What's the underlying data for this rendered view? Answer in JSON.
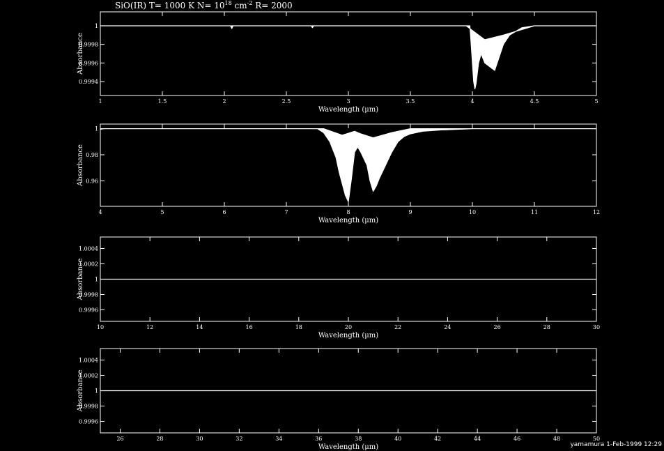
{
  "title": {
    "prefix": "SiO(IR) T= 1000 K N= 10",
    "exponent": "18",
    "unit": " cm",
    "unit_exponent": "-2",
    "suffix": " R= 2000"
  },
  "footer": "yamamura  1-Feb-1999 12:29",
  "colors": {
    "background": "#000000",
    "foreground": "#ffffff"
  },
  "chart_data": [
    {
      "type": "line",
      "xlabel": "Wavelength (μm)",
      "ylabel": "Absorbance",
      "xlim": [
        1,
        5
      ],
      "ylim": [
        0.99925,
        1.00015
      ],
      "xticks": [
        1,
        1.5,
        2,
        2.5,
        3,
        3.5,
        4,
        4.5,
        5
      ],
      "xtick_labels": [
        "1",
        "1.5",
        "2",
        "2.5",
        "3",
        "3.5",
        "4",
        "4.5",
        "5"
      ],
      "yticks": [
        0.9994,
        0.9996,
        0.9998,
        1
      ],
      "ytick_labels": [
        "0.9994",
        "0.9996",
        "0.9998",
        "1"
      ],
      "upper_envelope": {
        "x": [
          1,
          3.95,
          4.0,
          4.1,
          4.25,
          4.5,
          5
        ],
        "y": [
          1.0,
          1.0,
          0.99995,
          0.99985,
          0.9999,
          1.0,
          1.0
        ]
      },
      "lower_envelope": {
        "x": [
          1,
          2.05,
          2.06,
          2.07,
          2.7,
          2.71,
          2.72,
          3.98,
          3.99,
          4.0,
          4.01,
          4.02,
          4.03,
          4.05,
          4.07,
          4.1,
          4.15,
          4.18,
          4.2,
          4.25,
          4.3,
          4.4,
          4.5,
          5
        ],
        "y": [
          1.0,
          1.0,
          0.99997,
          1.0,
          1.0,
          0.99998,
          1.0,
          1.0,
          0.9998,
          0.9996,
          0.9994,
          0.99932,
          0.99938,
          0.9996,
          0.9997,
          0.9996,
          0.99955,
          0.99952,
          0.9996,
          0.9998,
          0.9999,
          0.99998,
          1.0,
          1.0
        ]
      }
    },
    {
      "type": "line",
      "xlabel": "Wavelength (μm)",
      "ylabel": "Absorbance",
      "xlim": [
        4,
        12
      ],
      "ylim": [
        0.9405,
        1.0035
      ],
      "xticks": [
        4,
        5,
        6,
        7,
        8,
        9,
        10,
        11,
        12
      ],
      "xtick_labels": [
        "4",
        "5",
        "6",
        "7",
        "8",
        "9",
        "10",
        "11",
        "12"
      ],
      "yticks": [
        0.96,
        0.98,
        1
      ],
      "ytick_labels": [
        "0.96",
        "0.98",
        "1"
      ],
      "upper_envelope": {
        "x": [
          4,
          7.6,
          7.9,
          8.1,
          8.2,
          8.4,
          8.7,
          9.0,
          12
        ],
        "y": [
          1.0,
          1.0,
          0.995,
          0.998,
          0.996,
          0.993,
          0.997,
          1.0,
          1.0
        ]
      },
      "lower_envelope": {
        "x": [
          4,
          4.05,
          7.5,
          7.6,
          7.7,
          7.8,
          7.85,
          7.9,
          7.95,
          8.0,
          8.05,
          8.1,
          8.15,
          8.2,
          8.3,
          8.35,
          8.4,
          8.45,
          8.5,
          8.6,
          8.7,
          8.8,
          8.9,
          9.0,
          9.2,
          9.5,
          10,
          12
        ],
        "y": [
          0.9995,
          1.0,
          1.0,
          0.997,
          0.99,
          0.978,
          0.967,
          0.958,
          0.949,
          0.944,
          0.962,
          0.982,
          0.986,
          0.982,
          0.972,
          0.96,
          0.952,
          0.956,
          0.962,
          0.972,
          0.982,
          0.99,
          0.994,
          0.996,
          0.998,
          0.999,
          1.0,
          1.0
        ]
      }
    },
    {
      "type": "line",
      "xlabel": "Wavelength (μm)",
      "ylabel": "Absorbance",
      "xlim": [
        10,
        30
      ],
      "ylim": [
        0.99945,
        1.00055
      ],
      "xticks": [
        10,
        12,
        14,
        16,
        18,
        20,
        22,
        24,
        26,
        28,
        30
      ],
      "xtick_labels": [
        "10",
        "12",
        "14",
        "16",
        "18",
        "20",
        "22",
        "24",
        "26",
        "28",
        "30"
      ],
      "yticks": [
        0.9996,
        0.9998,
        1,
        1.0002,
        1.0004
      ],
      "ytick_labels": [
        "0.9996",
        "0.9998",
        "1",
        "1.0002",
        "1.0004"
      ],
      "upper_envelope": {
        "x": [
          10,
          30
        ],
        "y": [
          1.0,
          1.0
        ]
      },
      "lower_envelope": {
        "x": [
          10,
          30
        ],
        "y": [
          1.0,
          1.0
        ]
      }
    },
    {
      "type": "line",
      "xlabel": "Wavelength (μm)",
      "ylabel": "Absorbance",
      "xlim": [
        25,
        50
      ],
      "ylim": [
        0.99945,
        1.00055
      ],
      "xticks": [
        26,
        28,
        30,
        32,
        34,
        36,
        38,
        40,
        42,
        44,
        46,
        48,
        50
      ],
      "xtick_labels": [
        "26",
        "28",
        "30",
        "32",
        "34",
        "36",
        "38",
        "40",
        "42",
        "44",
        "46",
        "48",
        "50"
      ],
      "yticks": [
        0.9996,
        0.9998,
        1,
        1.0002,
        1.0004
      ],
      "ytick_labels": [
        "0.9996",
        "0.9998",
        "1",
        "1.0002",
        "1.0004"
      ],
      "upper_envelope": {
        "x": [
          25,
          50
        ],
        "y": [
          1.0,
          1.0
        ]
      },
      "lower_envelope": {
        "x": [
          25,
          50
        ],
        "y": [
          1.0,
          1.0
        ]
      }
    }
  ]
}
